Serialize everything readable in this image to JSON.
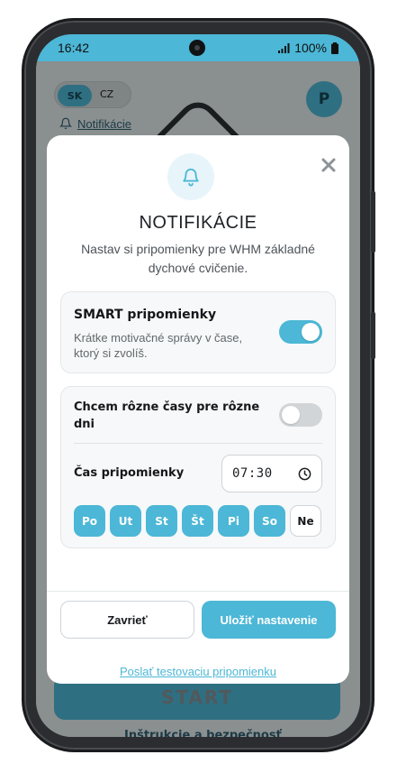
{
  "status_bar": {
    "time": "16:42",
    "battery": "100%"
  },
  "background_app": {
    "lang_sk": "SK",
    "lang_cz": "CZ",
    "avatar_initial": "P",
    "notifications_link": "Notifikácie",
    "start_button": "START",
    "instructions_link": "Inštrukcie a bezpečnosť"
  },
  "modal": {
    "title": "NOTIFIKÁCIE",
    "subtitle": "Nastav si pripomienky pre WHM základné dychové cvičenie.",
    "smart_card": {
      "title": "SMART pripomienky",
      "description": "Krátke motivačné správy v čase, ktorý si zvolíš.",
      "enabled": true
    },
    "schedule_card": {
      "different_times_label": "Chcem rôzne časy pre rôzne dni",
      "different_times_enabled": false,
      "time_label": "Čas pripomienky",
      "time_value": "07:30",
      "days": [
        {
          "label": "Po",
          "active": true
        },
        {
          "label": "Ut",
          "active": true
        },
        {
          "label": "St",
          "active": true
        },
        {
          "label": "Št",
          "active": true
        },
        {
          "label": "Pi",
          "active": true
        },
        {
          "label": "So",
          "active": true
        },
        {
          "label": "Ne",
          "active": false
        }
      ]
    },
    "close_button": "Zavrieť",
    "save_button": "Uložiť nastavenie",
    "test_link": "Poslať testovaciu pripomienku"
  },
  "colors": {
    "accent": "#4cb7d6",
    "status_bar": "#4cb7d6"
  }
}
